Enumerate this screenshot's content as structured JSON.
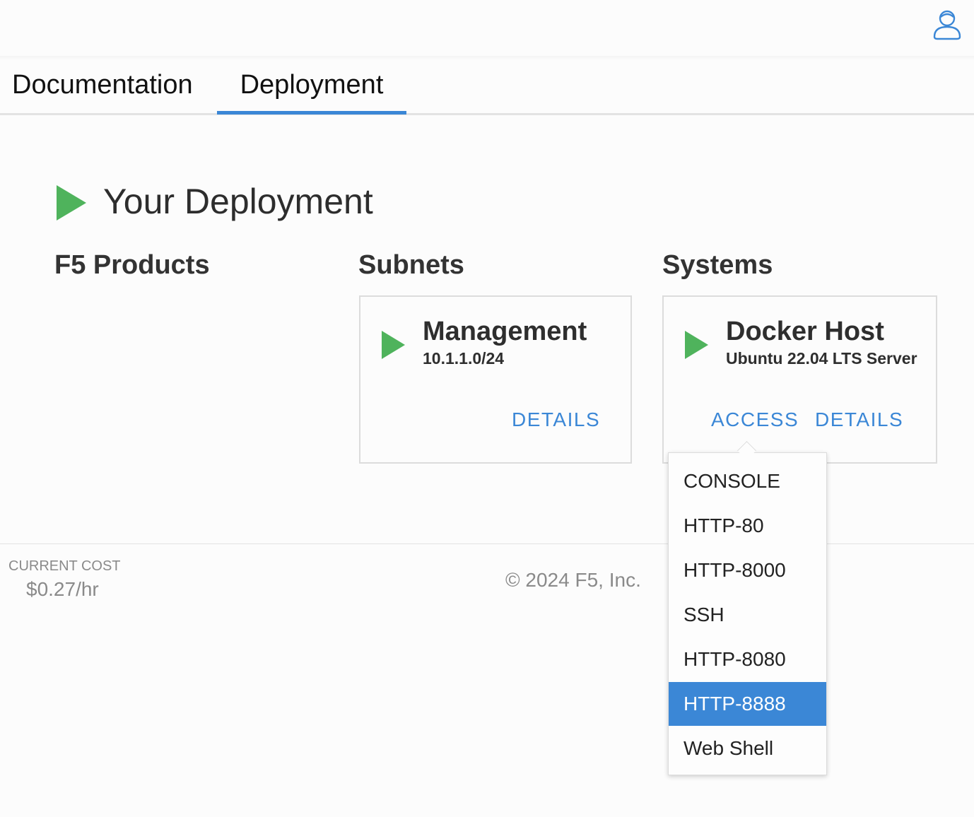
{
  "header": {
    "user_icon": "user-icon"
  },
  "tabs": [
    {
      "label": "Documentation",
      "active": false
    },
    {
      "label": "Deployment",
      "active": true
    }
  ],
  "accent_color": "#3b87d6",
  "play_color": "#4fb35c",
  "page_title": "Your Deployment",
  "columns": {
    "products": {
      "title": "F5 Products"
    },
    "subnets": {
      "title": "Subnets",
      "card": {
        "name": "Management",
        "subtitle": "10.1.1.0/24",
        "details_label": "DETAILS"
      }
    },
    "systems": {
      "title": "Systems",
      "card": {
        "name": "Docker Host",
        "subtitle": "Ubuntu 22.04 LTS Server",
        "access_label": "ACCESS",
        "details_label": "DETAILS"
      }
    }
  },
  "access_menu": {
    "items": [
      "CONSOLE",
      "HTTP-80",
      "HTTP-8000",
      "SSH",
      "HTTP-8080",
      "HTTP-8888",
      "Web Shell"
    ],
    "highlighted": "HTTP-8888"
  },
  "footer": {
    "cost_label": "CURRENT COST",
    "cost_value": "$0.27/hr",
    "copyright": "© 2024 F5, Inc."
  }
}
